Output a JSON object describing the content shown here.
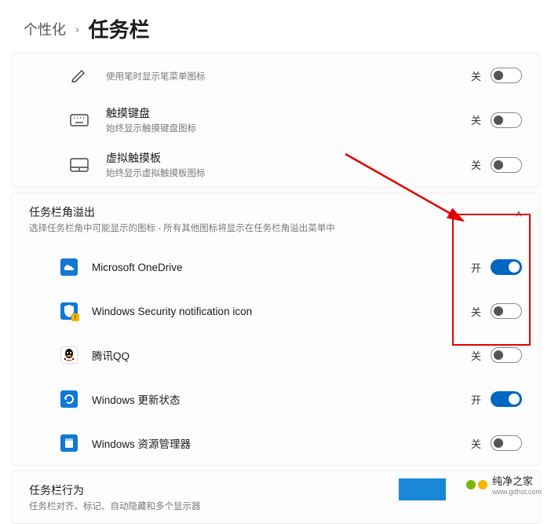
{
  "breadcrumb": {
    "parent": "个性化",
    "separator": "›",
    "current": "任务栏"
  },
  "topCard": {
    "items": [
      {
        "icon": "pen",
        "title_partial": "使用笔时显示笔菜单图标",
        "state": "关",
        "on": false
      },
      {
        "icon": "keyboard",
        "title": "触摸键盘",
        "sub": "始终显示触摸键盘图标",
        "state": "关",
        "on": false
      },
      {
        "icon": "touchpad",
        "title": "虚拟触摸板",
        "sub": "始终显示虚拟触摸板图标",
        "state": "关",
        "on": false
      }
    ]
  },
  "overflow": {
    "title": "任务栏角溢出",
    "sub": "选择任务栏角中可能显示的图标 - 所有其他图标将显示在任务栏角溢出菜单中",
    "chevron": "˄",
    "items": [
      {
        "icon_bg": "#1078d4",
        "label": "Microsoft OneDrive",
        "state": "开",
        "on": true
      },
      {
        "icon_bg": "#1078d4",
        "label": "Windows Security notification icon",
        "state": "关",
        "on": false
      },
      {
        "icon_bg": "#ffffff",
        "label": "腾讯QQ",
        "state": "关",
        "on": false
      },
      {
        "icon_bg": "#1078d4",
        "label": "Windows 更新状态",
        "state": "开",
        "on": true
      },
      {
        "icon_bg": "#1078d4",
        "label": "Windows 资源管理器",
        "state": "关",
        "on": false
      }
    ]
  },
  "behavior": {
    "title": "任务栏行为",
    "sub": "任务栏对齐、标记、自动隐藏和多个显示器"
  },
  "watermark": {
    "text": "纯净之家",
    "domain": "www.gdhst.com"
  }
}
